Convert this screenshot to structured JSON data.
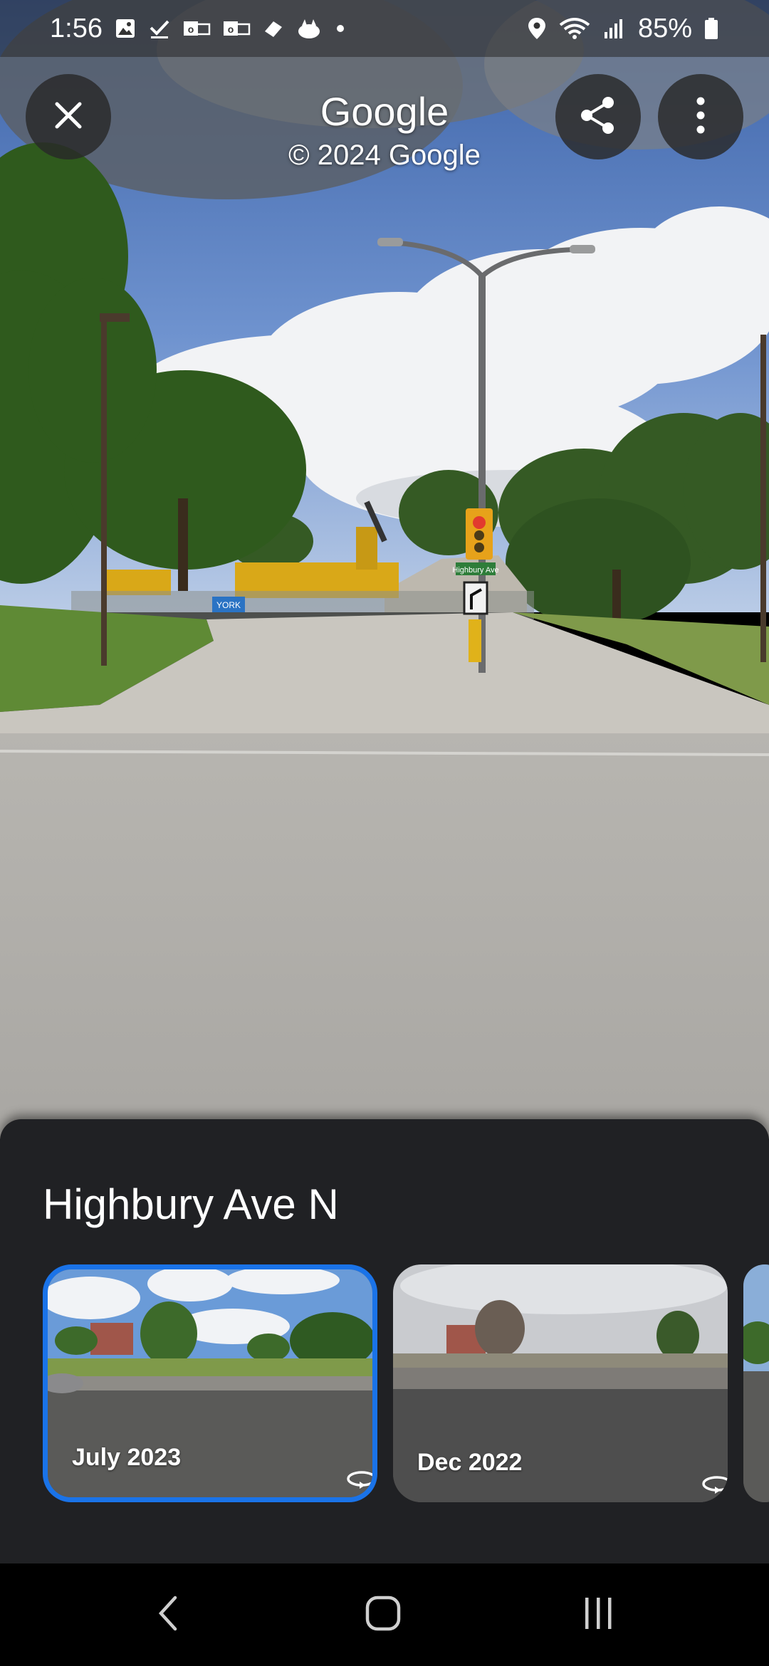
{
  "status_bar": {
    "time": "1:56",
    "battery": "85%",
    "left_icons": [
      "gallery-icon",
      "check-icon",
      "outlook-icon",
      "outlook-icon",
      "eraser-icon",
      "cat-icon",
      "dot-icon"
    ],
    "right_icons": [
      "location-icon",
      "wifi-icon",
      "signal-icon",
      "battery-icon"
    ]
  },
  "header": {
    "title": "Google",
    "copyright": "© 2024 Google",
    "buttons": [
      "close-icon",
      "share-icon",
      "more-vert-icon"
    ]
  },
  "photo": {
    "street_sign": "Highbury Ave",
    "fence_banner": "YORK"
  },
  "sheet": {
    "place_name": "Highbury Ave N",
    "timeline": [
      {
        "label": "July 2023",
        "selected": true,
        "icon": "360-rotate-icon"
      },
      {
        "label": "Dec 2022",
        "selected": false,
        "icon": "360-rotate-icon"
      }
    ]
  },
  "nav_bar": [
    "back-icon",
    "home-icon",
    "recent-apps-icon"
  ],
  "colors": {
    "accent": "#1a73e8",
    "sheet_bg": "#202124",
    "overlay_btn": "#282828"
  }
}
